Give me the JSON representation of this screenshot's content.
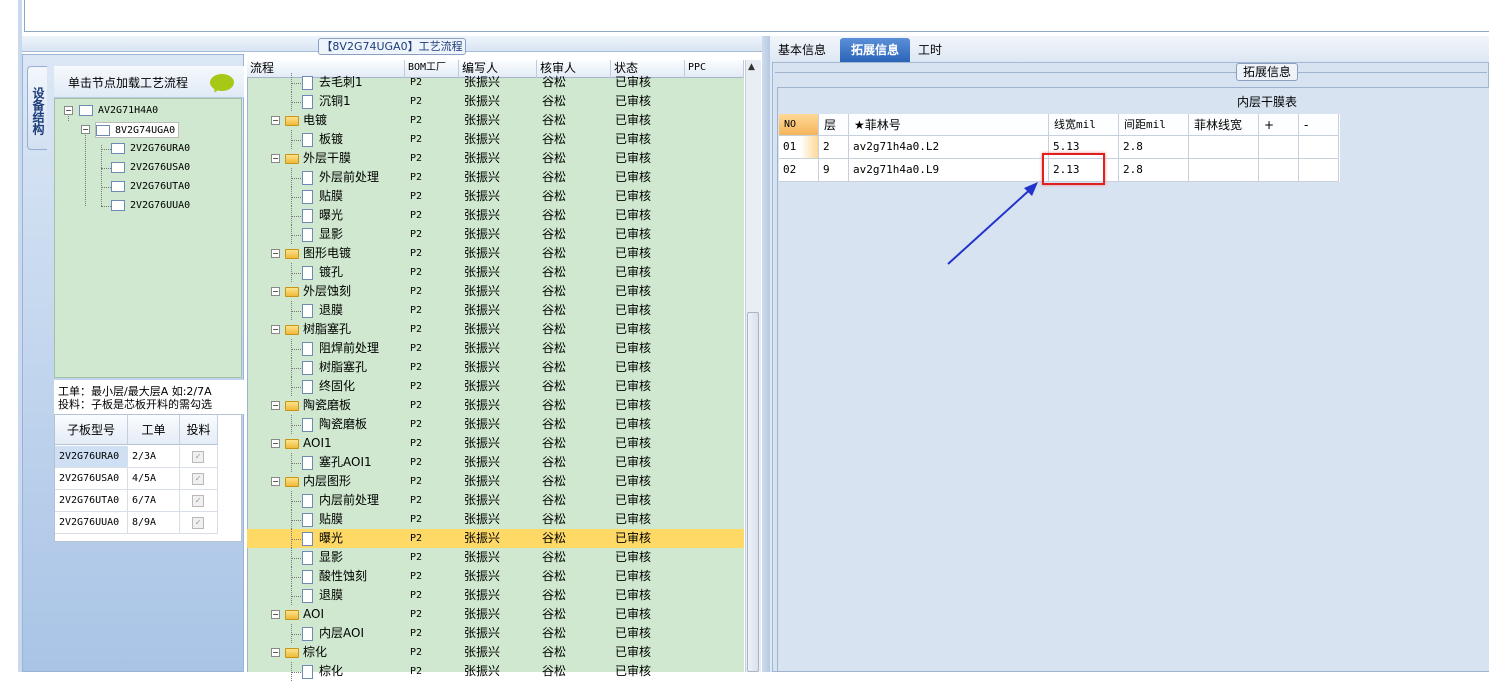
{
  "left_panel": {
    "title": "【8V2G74UGA0】工艺流程",
    "vertical_tab": "设备结构",
    "load_hint": "单击节点加载工艺流程",
    "tree": [
      {
        "label": "AV2G71H4A0",
        "level": 0
      },
      {
        "label": "8V2G74UGA0",
        "level": 1
      },
      {
        "label": "2V2G76URA0",
        "level": 2
      },
      {
        "label": "2V2G76USA0",
        "level": 2
      },
      {
        "label": "2V2G76UTA0",
        "level": 2
      },
      {
        "label": "2V2G76UUA0",
        "level": 2
      }
    ],
    "info_line1": "工单：最小层/最大层A 如:2/7A",
    "info_line2": "投料：子板是芯板开料的需勾选",
    "subtable": {
      "headers": [
        "子板型号",
        "工单",
        "投料"
      ],
      "rows": [
        {
          "model": "2V2G76URA0",
          "order": "2/3A"
        },
        {
          "model": "2V2G76USA0",
          "order": "4/5A"
        },
        {
          "model": "2V2G76UTA0",
          "order": "6/7A"
        },
        {
          "model": "2V2G76UUA0",
          "order": "8/9A"
        }
      ]
    }
  },
  "process_grid": {
    "headers": [
      "流程",
      "BOM工厂",
      "编写人",
      "核审人",
      "状态",
      "PPC"
    ],
    "rows": [
      {
        "name": "去毛刺1",
        "type": "doc",
        "factory": "P2",
        "writer": "张振兴",
        "reviewer": "谷松",
        "status": "已审核"
      },
      {
        "name": "沉铜1",
        "type": "doc",
        "factory": "P2",
        "writer": "张振兴",
        "reviewer": "谷松",
        "status": "已审核"
      },
      {
        "name": "电镀",
        "type": "folder",
        "factory": "P2",
        "writer": "张振兴",
        "reviewer": "谷松",
        "status": "已审核"
      },
      {
        "name": "板镀",
        "type": "doc",
        "factory": "P2",
        "writer": "张振兴",
        "reviewer": "谷松",
        "status": "已审核"
      },
      {
        "name": "外层干膜",
        "type": "folder",
        "factory": "P2",
        "writer": "张振兴",
        "reviewer": "谷松",
        "status": "已审核"
      },
      {
        "name": "外层前处理",
        "type": "doc",
        "factory": "P2",
        "writer": "张振兴",
        "reviewer": "谷松",
        "status": "已审核"
      },
      {
        "name": "贴膜",
        "type": "doc",
        "factory": "P2",
        "writer": "张振兴",
        "reviewer": "谷松",
        "status": "已审核"
      },
      {
        "name": "曝光",
        "type": "doc",
        "factory": "P2",
        "writer": "张振兴",
        "reviewer": "谷松",
        "status": "已审核"
      },
      {
        "name": "显影",
        "type": "doc",
        "factory": "P2",
        "writer": "张振兴",
        "reviewer": "谷松",
        "status": "已审核"
      },
      {
        "name": "图形电镀",
        "type": "folder",
        "factory": "P2",
        "writer": "张振兴",
        "reviewer": "谷松",
        "status": "已审核"
      },
      {
        "name": "镀孔",
        "type": "doc",
        "factory": "P2",
        "writer": "张振兴",
        "reviewer": "谷松",
        "status": "已审核"
      },
      {
        "name": "外层蚀刻",
        "type": "folder",
        "factory": "P2",
        "writer": "张振兴",
        "reviewer": "谷松",
        "status": "已审核"
      },
      {
        "name": "退膜",
        "type": "doc",
        "factory": "P2",
        "writer": "张振兴",
        "reviewer": "谷松",
        "status": "已审核"
      },
      {
        "name": "树脂塞孔",
        "type": "folder",
        "factory": "P2",
        "writer": "张振兴",
        "reviewer": "谷松",
        "status": "已审核"
      },
      {
        "name": "阻焊前处理",
        "type": "doc",
        "factory": "P2",
        "writer": "张振兴",
        "reviewer": "谷松",
        "status": "已审核"
      },
      {
        "name": "树脂塞孔",
        "type": "doc",
        "factory": "P2",
        "writer": "张振兴",
        "reviewer": "谷松",
        "status": "已审核"
      },
      {
        "name": "终固化",
        "type": "doc",
        "factory": "P2",
        "writer": "张振兴",
        "reviewer": "谷松",
        "status": "已审核"
      },
      {
        "name": "陶瓷磨板",
        "type": "folder",
        "factory": "P2",
        "writer": "张振兴",
        "reviewer": "谷松",
        "status": "已审核"
      },
      {
        "name": "陶瓷磨板",
        "type": "doc",
        "factory": "P2",
        "writer": "张振兴",
        "reviewer": "谷松",
        "status": "已审核"
      },
      {
        "name": "AOI1",
        "type": "folder",
        "factory": "P2",
        "writer": "张振兴",
        "reviewer": "谷松",
        "status": "已审核"
      },
      {
        "name": "塞孔AOI1",
        "type": "doc",
        "factory": "P2",
        "writer": "张振兴",
        "reviewer": "谷松",
        "status": "已审核"
      },
      {
        "name": "内层图形",
        "type": "folder",
        "factory": "P2",
        "writer": "张振兴",
        "reviewer": "谷松",
        "status": "已审核"
      },
      {
        "name": "内层前处理",
        "type": "doc",
        "factory": "P2",
        "writer": "张振兴",
        "reviewer": "谷松",
        "status": "已审核"
      },
      {
        "name": "贴膜",
        "type": "doc",
        "factory": "P2",
        "writer": "张振兴",
        "reviewer": "谷松",
        "status": "已审核"
      },
      {
        "name": "曝光",
        "type": "doc",
        "factory": "P2",
        "writer": "张振兴",
        "reviewer": "谷松",
        "status": "已审核",
        "selected": true
      },
      {
        "name": "显影",
        "type": "doc",
        "factory": "P2",
        "writer": "张振兴",
        "reviewer": "谷松",
        "status": "已审核"
      },
      {
        "name": "酸性蚀刻",
        "type": "doc",
        "factory": "P2",
        "writer": "张振兴",
        "reviewer": "谷松",
        "status": "已审核"
      },
      {
        "name": "退膜",
        "type": "doc",
        "factory": "P2",
        "writer": "张振兴",
        "reviewer": "谷松",
        "status": "已审核"
      },
      {
        "name": "AOI",
        "type": "folder",
        "factory": "P2",
        "writer": "张振兴",
        "reviewer": "谷松",
        "status": "已审核"
      },
      {
        "name": "内层AOI",
        "type": "doc",
        "factory": "P2",
        "writer": "张振兴",
        "reviewer": "谷松",
        "status": "已审核"
      },
      {
        "name": "棕化",
        "type": "folder",
        "factory": "P2",
        "writer": "张振兴",
        "reviewer": "谷松",
        "status": "已审核"
      },
      {
        "name": "棕化",
        "type": "doc",
        "factory": "P2",
        "writer": "张振兴",
        "reviewer": "谷松",
        "status": "已审核"
      }
    ]
  },
  "right_panel": {
    "tabs": [
      "基本信息",
      "拓展信息",
      "工时"
    ],
    "active_tab": "拓展信息",
    "group_title": "拓展信息",
    "table_caption": "内层干膜表",
    "columns": [
      "NO",
      "层",
      "★菲林号",
      "线宽mil",
      "间距mil",
      "菲林线宽",
      "+",
      "-"
    ],
    "rows": [
      {
        "no": "01",
        "layer": "2",
        "film": "av2g71h4a0.L2",
        "width": "5.13",
        "spacing": "2.8",
        "film_width": ""
      },
      {
        "no": "02",
        "layer": "9",
        "film": "av2g71h4a0.L9",
        "width": "2.13",
        "spacing": "2.8",
        "film_width": ""
      }
    ],
    "highlight_color": "#e02020",
    "arrow_color": "#2233cc"
  }
}
